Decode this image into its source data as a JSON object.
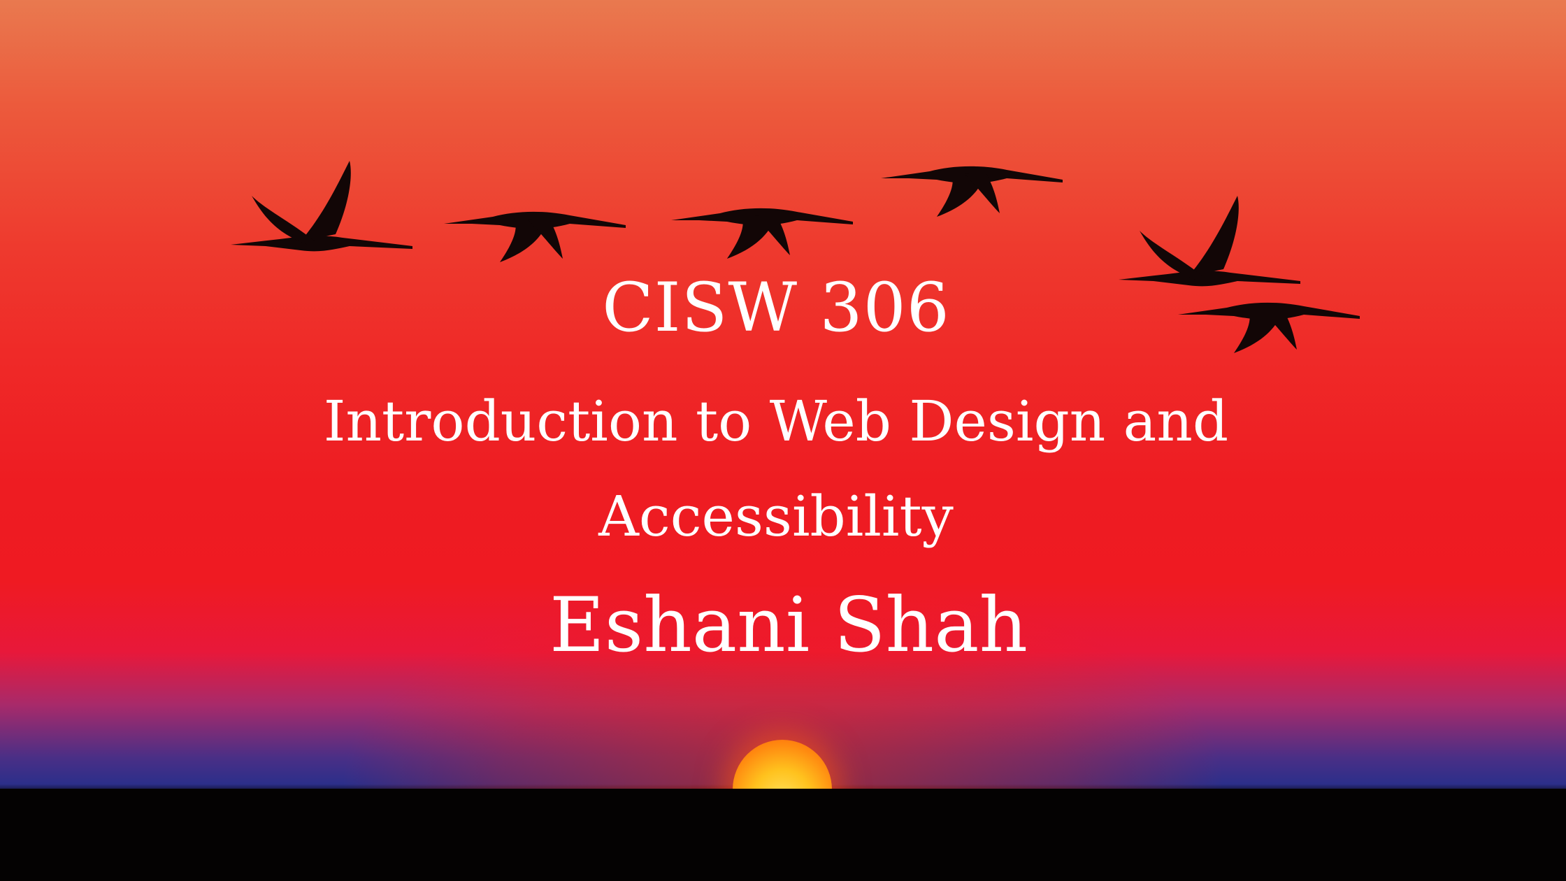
{
  "slide": {
    "course_code": "CISW 306",
    "course_title_line1": "Introduction to Web Design and",
    "course_title_line2": "Accessibility",
    "instructor": "Eshani Shah"
  },
  "colors": {
    "text": "#ffffff",
    "sky_top": "#e9794f",
    "sky_mid": "#ee1c22",
    "horizon": "#2c2f8a",
    "sun": "#ffc21e",
    "ground": "#040202"
  },
  "icons": [
    "crane-silhouette-icon",
    "setting-sun-icon"
  ]
}
